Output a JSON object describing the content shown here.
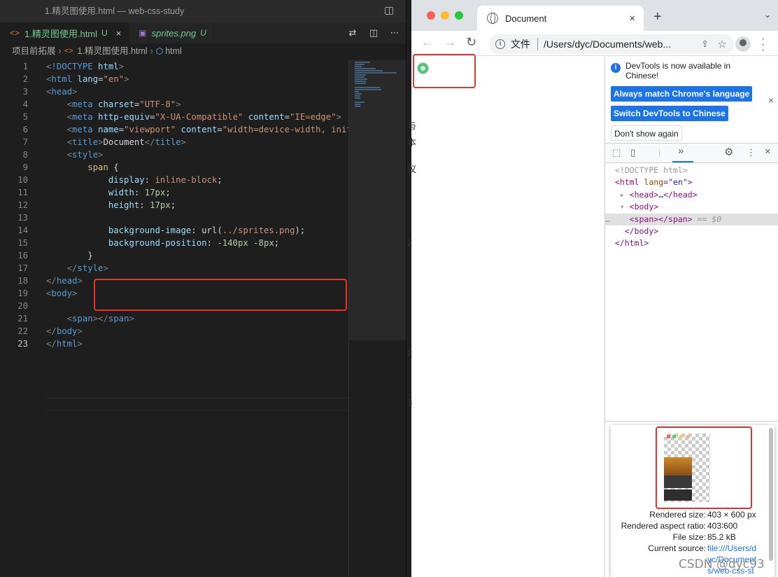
{
  "vscode": {
    "window_title": "1.精灵图使用.html — web-css-study",
    "tabs": [
      {
        "icon": "<>",
        "name": "1.精灵图使用.html",
        "status": "U",
        "close": "×"
      },
      {
        "icon": "▣",
        "name": "sprites.png",
        "status": "U"
      }
    ],
    "breadcrumb": {
      "folder": "项目前拓展",
      "file": "1.精灵图使用.html",
      "element": "html"
    },
    "lines": [
      {
        "n": "1",
        "html": "<span class=\"p\">&lt;</span><span class=\"k\">!DOCTYPE</span> <span class=\"a\">html</span><span class=\"p\">&gt;</span>"
      },
      {
        "n": "2",
        "html": "<span class=\"p\">&lt;</span><span class=\"k\">html</span> <span class=\"a\">lang</span><span class=\"t\">=</span><span class=\"s\">\"en\"</span><span class=\"p\">&gt;</span>"
      },
      {
        "n": "3",
        "html": "<span class=\"p\">&lt;</span><span class=\"k\">head</span><span class=\"p\">&gt;</span>"
      },
      {
        "n": "4",
        "html": "    <span class=\"p\">&lt;</span><span class=\"k\">meta</span> <span class=\"a\">charset</span><span class=\"t\">=</span><span class=\"s\">\"UTF-8\"</span><span class=\"p\">&gt;</span>"
      },
      {
        "n": "5",
        "html": "    <span class=\"p\">&lt;</span><span class=\"k\">meta</span> <span class=\"a\">http-equiv</span><span class=\"t\">=</span><span class=\"s\">\"X-UA-Compatible\"</span> <span class=\"a\">content</span><span class=\"t\">=</span><span class=\"s\">\"IE=edge\"</span><span class=\"p\">&gt;</span>"
      },
      {
        "n": "6",
        "html": "    <span class=\"p\">&lt;</span><span class=\"k\">meta</span> <span class=\"a\">name</span><span class=\"t\">=</span><span class=\"s\">\"viewport\"</span> <span class=\"a\">content</span><span class=\"t\">=</span><span class=\"s\">\"width=device-width, initi</span>"
      },
      {
        "n": "7",
        "html": "    <span class=\"p\">&lt;</span><span class=\"k\">title</span><span class=\"p\">&gt;</span><span class=\"t\">Document</span><span class=\"p\">&lt;/</span><span class=\"k\">title</span><span class=\"p\">&gt;</span>"
      },
      {
        "n": "8",
        "html": "    <span class=\"p\">&lt;</span><span class=\"k\">style</span><span class=\"p\">&gt;</span>"
      },
      {
        "n": "9",
        "html": "        <span class=\"sel\">span</span> <span class=\"t\">{</span>"
      },
      {
        "n": "10",
        "html": "            <span class=\"a\">display</span><span class=\"t\">:</span> <span class=\"s\">inline-block</span><span class=\"t\">;</span>"
      },
      {
        "n": "11",
        "html": "            <span class=\"a\">width</span><span class=\"t\">:</span> <span class=\"n\">17px</span><span class=\"t\">;</span>"
      },
      {
        "n": "12",
        "html": "            <span class=\"a\">height</span><span class=\"t\">:</span> <span class=\"n\">17px</span><span class=\"t\">;</span>"
      },
      {
        "n": "13",
        "html": ""
      },
      {
        "n": "14",
        "html": "            <span class=\"a\">background-image</span><span class=\"t\">:</span> <span class=\"t\">url(</span><span class=\"s\">../sprites.png</span><span class=\"t\">);</span>"
      },
      {
        "n": "15",
        "html": "            <span class=\"a\">background-position</span><span class=\"t\">:</span> <span class=\"n\">-140px -8px</span><span class=\"t\">;</span>"
      },
      {
        "n": "16",
        "html": "        <span class=\"t\">}</span>"
      },
      {
        "n": "17",
        "html": "    <span class=\"p\">&lt;/</span><span class=\"k\">style</span><span class=\"p\">&gt;</span>"
      },
      {
        "n": "18",
        "html": "<span class=\"p\">&lt;/</span><span class=\"k\">head</span><span class=\"p\">&gt;</span>"
      },
      {
        "n": "19",
        "html": "<span class=\"p\">&lt;</span><span class=\"k\">body</span><span class=\"p\">&gt;</span>"
      },
      {
        "n": "20",
        "html": ""
      },
      {
        "n": "21",
        "html": "    <span class=\"p\">&lt;</span><span class=\"k\">span</span><span class=\"p\">&gt;&lt;/</span><span class=\"k\">span</span><span class=\"p\">&gt;</span>"
      },
      {
        "n": "22",
        "html": "<span class=\"p\">&lt;/</span><span class=\"k\">body</span><span class=\"p\">&gt;</span>"
      },
      {
        "n": "23",
        "html": "<span class=\"p\">&lt;/</span><span class=\"k\">html</span><span class=\"p\">&gt;</span>"
      }
    ],
    "current_line": "23"
  },
  "chrome": {
    "tab_title": "Document",
    "tab_close": "×",
    "new_tab": "+",
    "omnibox_chip": "文件",
    "omnibox_url": "/Users/dyc/Documents/web...",
    "page_sliver_text": [
      "与",
      "本",
      "议",
      "2",
      "2",
      "3"
    ]
  },
  "devtools": {
    "banner_message": "DevTools is now available in Chinese!",
    "banner_buttons": [
      "Always match Chrome's language",
      "Switch DevTools to Chinese",
      "Don't show again"
    ],
    "banner_close": "×",
    "more_tabs": "»",
    "elements": [
      {
        "indent": "  ",
        "html": "<span class=\"gr\">&lt;!DOCTYPE html&gt;</span>"
      },
      {
        "indent": "  ",
        "html": "&lt;html <span class=\"at\">lang</span>=\"<span class=\"av\">en</span>\"&gt;"
      },
      {
        "indent": "   ",
        "html": "<span class=\"gr\">▸</span> &lt;head&gt;<span class=\"tx\">…</span>&lt;/head&gt;"
      },
      {
        "indent": "   ",
        "html": "<span class=\"gr\">▾</span> &lt;body&gt;"
      },
      {
        "indent": "",
        "html": "<span class=\"gr\">…</span>    &lt;span&gt;&lt;/span&gt; <span class=\"gr\">== <i>$0</i></span>"
      },
      {
        "indent": "    ",
        "html": "&lt;/body&gt;"
      },
      {
        "indent": "  ",
        "html": "&lt;/html&gt;"
      }
    ],
    "tooltip": {
      "rows": [
        {
          "label": "Rendered size:",
          "value": "403 × 600 px"
        },
        {
          "label": "Rendered aspect ratio:",
          "value": "403∶600"
        },
        {
          "label": "File size:",
          "value": "85.2 kB"
        },
        {
          "label": "Current source:",
          "value": "file:///Users/d"
        }
      ],
      "source_cont": [
        "yc/Document",
        "s/web-css-st"
      ]
    }
  },
  "watermark": "CSDN @dyc93"
}
